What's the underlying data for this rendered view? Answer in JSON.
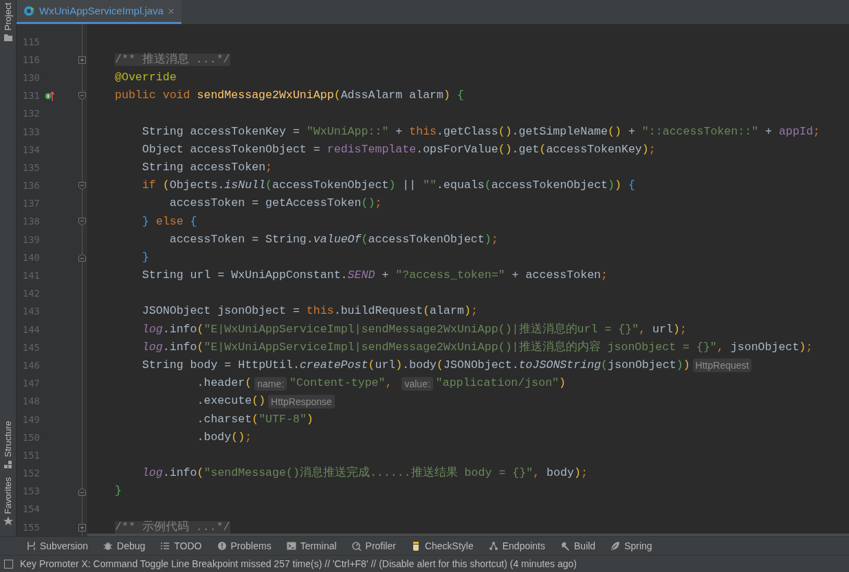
{
  "left_toolbar": {
    "top": [
      {
        "label": "Project"
      }
    ],
    "bottom": [
      {
        "label": "Structure"
      },
      {
        "label": "Favorites"
      }
    ]
  },
  "tabs": [
    {
      "label": "WxUniAppServiceImpl.java",
      "selected": true,
      "close": "×"
    }
  ],
  "editor": {
    "lines": [
      {
        "number": "115"
      },
      {
        "number": "116",
        "fold_marker": {
          "kind": "folded"
        },
        "tokens": [
          {
            "kind": "folded",
            "text": "/** 推送消息 ...*/"
          }
        ]
      },
      {
        "number": "130",
        "tokens": [
          {
            "kind": "anno",
            "text": "@Override"
          }
        ]
      },
      {
        "number": "131",
        "gutter_marker": {
          "kind": "implements"
        },
        "fold_marker": {
          "kind": "start"
        },
        "tokens": [
          {
            "kind": "kw",
            "text": "public void "
          },
          {
            "kind": "decl",
            "text": "sendMessage2WxUniApp"
          },
          {
            "kind": "paren1",
            "text": "("
          },
          {
            "kind": "plain",
            "text": "AdssAlarm alarm"
          },
          {
            "kind": "paren1",
            "text": ") "
          },
          {
            "kind": "brace2",
            "text": "{"
          }
        ]
      },
      {
        "number": "132"
      },
      {
        "number": "133",
        "tokens": [
          {
            "kind": "plain",
            "text": "    String accessTokenKey = "
          },
          {
            "kind": "str",
            "text": "\"WxUniApp::\""
          },
          {
            "kind": "plain",
            "text": " + "
          },
          {
            "kind": "kw",
            "text": "this"
          },
          {
            "kind": "plain",
            "text": ".getClass"
          },
          {
            "kind": "paren1",
            "text": "()"
          },
          {
            "kind": "plain",
            "text": ".getSimpleName"
          },
          {
            "kind": "paren1",
            "text": "()"
          },
          {
            "kind": "plain",
            "text": " + "
          },
          {
            "kind": "str",
            "text": "\"::accessToken::\""
          },
          {
            "kind": "plain",
            "text": " + "
          },
          {
            "kind": "field",
            "text": "appId"
          },
          {
            "kind": "punct",
            "text": ";"
          }
        ]
      },
      {
        "number": "134",
        "tokens": [
          {
            "kind": "plain",
            "text": "    Object accessTokenObject = "
          },
          {
            "kind": "field",
            "text": "redisTemplate"
          },
          {
            "kind": "plain",
            "text": ".opsForValue"
          },
          {
            "kind": "paren1",
            "text": "()"
          },
          {
            "kind": "plain",
            "text": ".get"
          },
          {
            "kind": "paren1",
            "text": "("
          },
          {
            "kind": "plain",
            "text": "accessTokenKey"
          },
          {
            "kind": "paren1",
            "text": ")"
          },
          {
            "kind": "punct",
            "text": ";"
          }
        ]
      },
      {
        "number": "135",
        "tokens": [
          {
            "kind": "plain",
            "text": "    String accessToken"
          },
          {
            "kind": "punct",
            "text": ";"
          }
        ]
      },
      {
        "number": "136",
        "fold_marker": {
          "kind": "start"
        },
        "tokens": [
          {
            "kind": "kw",
            "text": "    if "
          },
          {
            "kind": "paren1",
            "text": "("
          },
          {
            "kind": "plain",
            "text": "Objects."
          },
          {
            "kind": "static-method",
            "text": "isNull"
          },
          {
            "kind": "paren2",
            "text": "("
          },
          {
            "kind": "plain",
            "text": "accessTokenObject"
          },
          {
            "kind": "paren2",
            "text": ")"
          },
          {
            "kind": "plain",
            "text": " || "
          },
          {
            "kind": "str",
            "text": "\"\""
          },
          {
            "kind": "plain",
            "text": ".equals"
          },
          {
            "kind": "paren2",
            "text": "("
          },
          {
            "kind": "plain",
            "text": "accessTokenObject"
          },
          {
            "kind": "paren2",
            "text": ")"
          },
          {
            "kind": "paren1",
            "text": ") "
          },
          {
            "kind": "brace1",
            "text": "{"
          }
        ]
      },
      {
        "number": "137",
        "tokens": [
          {
            "kind": "plain",
            "text": "        accessToken = getAccessToken"
          },
          {
            "kind": "paren2",
            "text": "()"
          },
          {
            "kind": "punct",
            "text": ";"
          }
        ]
      },
      {
        "number": "138",
        "fold_marker": {
          "kind": "start"
        },
        "tokens": [
          {
            "kind": "brace1",
            "text": "    }"
          },
          {
            "kind": "kw",
            "text": " else "
          },
          {
            "kind": "brace1",
            "text": "{"
          }
        ]
      },
      {
        "number": "139",
        "tokens": [
          {
            "kind": "plain",
            "text": "        accessToken = String."
          },
          {
            "kind": "static-method",
            "text": "valueOf"
          },
          {
            "kind": "paren2",
            "text": "("
          },
          {
            "kind": "plain",
            "text": "accessTokenObject"
          },
          {
            "kind": "paren2",
            "text": ")"
          },
          {
            "kind": "punct",
            "text": ";"
          }
        ]
      },
      {
        "number": "140",
        "fold_marker": {
          "kind": "end"
        },
        "tokens": [
          {
            "kind": "brace1",
            "text": "    }"
          }
        ]
      },
      {
        "number": "141",
        "tokens": [
          {
            "kind": "plain",
            "text": "    String url = WxUniAppConstant."
          },
          {
            "kind": "static-field",
            "text": "SEND"
          },
          {
            "kind": "plain",
            "text": " + "
          },
          {
            "kind": "str",
            "text": "\"?access_token=\""
          },
          {
            "kind": "plain",
            "text": " + accessToken"
          },
          {
            "kind": "punct",
            "text": ";"
          }
        ]
      },
      {
        "number": "142"
      },
      {
        "number": "143",
        "tokens": [
          {
            "kind": "plain",
            "text": "    JSONObject jsonObject = "
          },
          {
            "kind": "kw",
            "text": "this"
          },
          {
            "kind": "plain",
            "text": ".buildRequest"
          },
          {
            "kind": "paren1",
            "text": "("
          },
          {
            "kind": "plain",
            "text": "alarm"
          },
          {
            "kind": "paren1",
            "text": ")"
          },
          {
            "kind": "punct",
            "text": ";"
          }
        ]
      },
      {
        "number": "144",
        "tokens": [
          {
            "kind": "static-field",
            "text": "    log"
          },
          {
            "kind": "plain",
            "text": ".info"
          },
          {
            "kind": "paren1",
            "text": "("
          },
          {
            "kind": "str",
            "text": "\"E|WxUniAppServiceImpl|sendMessage2WxUniApp()|推送消息的url = {}\""
          },
          {
            "kind": "punct",
            "text": ", "
          },
          {
            "kind": "plain",
            "text": "url"
          },
          {
            "kind": "paren1",
            "text": ")"
          },
          {
            "kind": "punct",
            "text": ";"
          }
        ]
      },
      {
        "number": "145",
        "tokens": [
          {
            "kind": "static-field",
            "text": "    log"
          },
          {
            "kind": "plain",
            "text": ".info"
          },
          {
            "kind": "paren1",
            "text": "("
          },
          {
            "kind": "str",
            "text": "\"E|WxUniAppServiceImpl|sendMessage2WxUniApp()|推送消息的内容 jsonObject = {}\""
          },
          {
            "kind": "punct",
            "text": ", "
          },
          {
            "kind": "plain",
            "text": "jsonObject"
          },
          {
            "kind": "paren1",
            "text": ")"
          },
          {
            "kind": "punct",
            "text": ";"
          }
        ]
      },
      {
        "number": "146",
        "tokens": [
          {
            "kind": "plain",
            "text": "    String body = HttpUtil."
          },
          {
            "kind": "static-method",
            "text": "createPost"
          },
          {
            "kind": "paren1",
            "text": "("
          },
          {
            "kind": "plain",
            "text": "url"
          },
          {
            "kind": "paren1",
            "text": ")"
          },
          {
            "kind": "plain",
            "text": ".body"
          },
          {
            "kind": "paren1",
            "text": "("
          },
          {
            "kind": "plain",
            "text": "JSONObject."
          },
          {
            "kind": "static-method",
            "text": "toJSONString"
          },
          {
            "kind": "paren2",
            "text": "("
          },
          {
            "kind": "plain",
            "text": "jsonObject"
          },
          {
            "kind": "paren2",
            "text": ")"
          },
          {
            "kind": "paren1",
            "text": ")"
          },
          {
            "kind": "hint",
            "text": "HttpRequest"
          }
        ]
      },
      {
        "number": "147",
        "tokens": [
          {
            "kind": "plain",
            "text": "            .header"
          },
          {
            "kind": "paren1",
            "text": "("
          },
          {
            "kind": "hint",
            "text": "name:"
          },
          {
            "kind": "str",
            "text": "\"Content-type\""
          },
          {
            "kind": "punct",
            "text": ", "
          },
          {
            "kind": "hint",
            "text": "value:"
          },
          {
            "kind": "str",
            "text": "\"application/json\""
          },
          {
            "kind": "paren1",
            "text": ")"
          }
        ]
      },
      {
        "number": "148",
        "tokens": [
          {
            "kind": "plain",
            "text": "            .execute"
          },
          {
            "kind": "paren1",
            "text": "()"
          },
          {
            "kind": "hint",
            "text": "HttpResponse"
          }
        ]
      },
      {
        "number": "149",
        "tokens": [
          {
            "kind": "plain",
            "text": "            .charset"
          },
          {
            "kind": "paren1",
            "text": "("
          },
          {
            "kind": "str",
            "text": "\"UTF-8\""
          },
          {
            "kind": "paren1",
            "text": ")"
          }
        ]
      },
      {
        "number": "150",
        "tokens": [
          {
            "kind": "plain",
            "text": "            .body"
          },
          {
            "kind": "paren1",
            "text": "()"
          },
          {
            "kind": "punct",
            "text": ";"
          }
        ]
      },
      {
        "number": "151"
      },
      {
        "number": "152",
        "tokens": [
          {
            "kind": "static-field",
            "text": "    log"
          },
          {
            "kind": "plain",
            "text": ".info"
          },
          {
            "kind": "paren1",
            "text": "("
          },
          {
            "kind": "str",
            "text": "\"sendMessage()消息推送完成......推送结果 body = {}\""
          },
          {
            "kind": "punct",
            "text": ", "
          },
          {
            "kind": "plain",
            "text": "body"
          },
          {
            "kind": "paren1",
            "text": ")"
          },
          {
            "kind": "punct",
            "text": ";"
          }
        ]
      },
      {
        "number": "153",
        "fold_marker": {
          "kind": "end"
        },
        "tokens": [
          {
            "kind": "brace2",
            "text": "}"
          }
        ]
      },
      {
        "number": "154"
      },
      {
        "number": "155",
        "fold_marker": {
          "kind": "folded"
        },
        "tokens": [
          {
            "kind": "folded",
            "text": "/** 示例代码 ...*/"
          }
        ]
      }
    ]
  },
  "tool_windows": [
    {
      "label": "Subversion"
    },
    {
      "label": "Debug"
    },
    {
      "label": "TODO"
    },
    {
      "label": "Problems"
    },
    {
      "label": "Terminal"
    },
    {
      "label": "Profiler"
    },
    {
      "label": "CheckStyle"
    },
    {
      "label": "Endpoints"
    },
    {
      "label": "Build"
    },
    {
      "label": "Spring"
    }
  ],
  "status_bar": {
    "message": "Key Promoter X: Command Toggle Line Breakpoint missed 257 time(s) // 'Ctrl+F8' // (Disable alert for this shortcut) (4 minutes ago)"
  }
}
